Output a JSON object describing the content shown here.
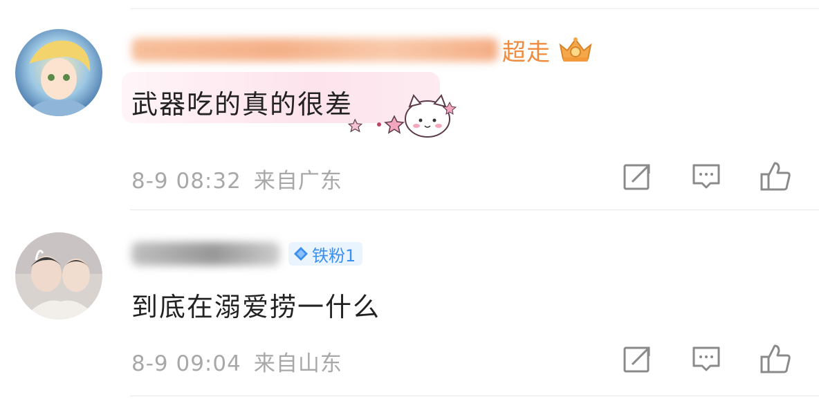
{
  "comments": [
    {
      "username_visible_end": "超走",
      "badge": {
        "kind": "crown",
        "icon": "crown-icon",
        "label": ""
      },
      "text": "武器吃的真的很差",
      "sticker": "cat-sticker",
      "time": "8-9 08:32",
      "location": "来自广东",
      "actions": [
        "share-icon",
        "comment-icon",
        "like-icon"
      ]
    },
    {
      "username_visible_end": "",
      "badge": {
        "kind": "fan",
        "icon": "diamond-icon",
        "label": "铁粉1"
      },
      "text": "到底在溺爱捞一什么",
      "time": "8-9 09:04",
      "location": "来自山东",
      "actions": [
        "share-icon",
        "comment-icon",
        "like-icon"
      ]
    }
  ],
  "colors": {
    "accent_name": "#ef8b3e",
    "meta_gray": "#a8a8a8",
    "fan_badge": "#3b8ff0"
  }
}
